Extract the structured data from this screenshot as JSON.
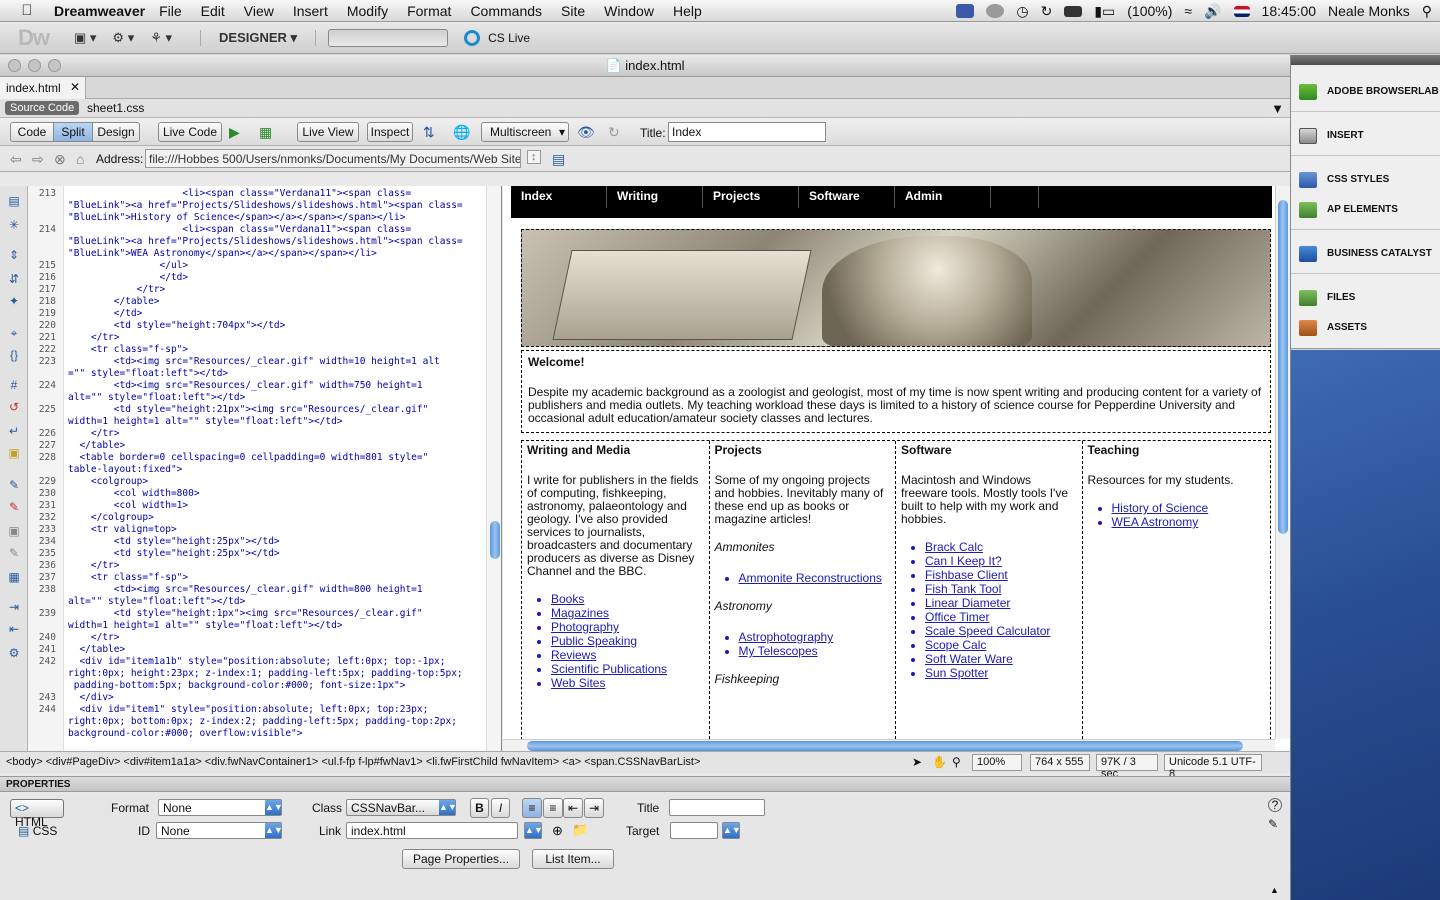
{
  "menubar": {
    "app_name": "Dreamweaver",
    "items": [
      "File",
      "Edit",
      "View",
      "Insert",
      "Modify",
      "Format",
      "Commands",
      "Site",
      "Window",
      "Help"
    ],
    "battery": "(100%)",
    "clock": "18:45:00",
    "user": "Neale Monks"
  },
  "appbar": {
    "logo": "Dw",
    "workspace": "DESIGNER ▾",
    "cslive": "CS Live"
  },
  "window": {
    "title": "index.html"
  },
  "tabs": {
    "active": "index.html"
  },
  "related": {
    "source": "Source Code",
    "css": "sheet1.css"
  },
  "toolbar": {
    "code": "Code",
    "split": "Split",
    "design": "Design",
    "live_code": "Live Code",
    "live_view": "Live View",
    "inspect": "Inspect",
    "multiscreen": "Multiscreen",
    "title_label": "Title:",
    "title_value": "Index"
  },
  "address": {
    "label": "Address:",
    "value": "file:///Hobbes 500/Users/nmonks/Documents/My Documents/Web Sites/M"
  },
  "code": {
    "line_numbers": [
      "213",
      "214",
      "215",
      "216",
      "217",
      "218",
      "219",
      "220",
      "221",
      "222",
      "223",
      "224",
      "225",
      "226",
      "227",
      "228",
      "229",
      "230",
      "231",
      "232",
      "233",
      "234",
      "235",
      "236",
      "237",
      "238",
      "239",
      "240",
      "241",
      "242",
      "243",
      "244"
    ],
    "lines": [
      "                    <li><span class=\"Verdana11\"><span class=\n\"BlueLink\"><a href=\"Projects/Slideshows/slideshows.html\"><span class=\n\"BlueLink\">History of Science</span></a></span></span></li>",
      "                    <li><span class=\"Verdana11\"><span class=\n\"BlueLink\"><a href=\"Projects/Slideshows/slideshows.html\"><span class=\n\"BlueLink\">WEA Astronomy</span></a></span></span></li>",
      "                </ul>",
      "                </td>",
      "            </tr>",
      "        </table>",
      "        </td>",
      "        <td style=\"height:704px\"></td>",
      "    </tr>",
      "    <tr class=\"f-sp\">",
      "        <td><img src=\"Resources/_clear.gif\" width=10 height=1 alt\n=\"\" style=\"float:left\"></td>",
      "        <td><img src=\"Resources/_clear.gif\" width=750 height=1\nalt=\"\" style=\"float:left\"></td>",
      "        <td style=\"height:21px\"><img src=\"Resources/_clear.gif\"\nwidth=1 height=1 alt=\"\" style=\"float:left\"></td>",
      "    </tr>",
      "  </table>",
      "  <table border=0 cellspacing=0 cellpadding=0 width=801 style=\"\ntable-layout:fixed\">",
      "    <colgroup>",
      "        <col width=800>",
      "        <col width=1>",
      "    </colgroup>",
      "    <tr valign=top>",
      "        <td style=\"height:25px\"></td>",
      "        <td style=\"height:25px\"></td>",
      "    </tr>",
      "    <tr class=\"f-sp\">",
      "        <td><img src=\"Resources/_clear.gif\" width=800 height=1\nalt=\"\" style=\"float:left\"></td>",
      "        <td style=\"height:1px\"><img src=\"Resources/_clear.gif\"\nwidth=1 height=1 alt=\"\" style=\"float:left\"></td>",
      "    </tr>",
      "  </table>",
      "  <div id=\"item1a1b\" style=\"position:absolute; left:0px; top:-1px;\nright:0px; height:23px; z-index:1; padding-left:5px; padding-top:5px;\n padding-bottom:5px; background-color:#000; font-size:1px\">",
      "  </div>",
      "  <div id=\"item1\" style=\"position:absolute; left:0px; top:23px;\nright:0px; bottom:0px; z-index:2; padding-left:5px; padding-top:2px;\nbackground-color:#000; overflow:visible\">"
    ]
  },
  "design": {
    "nav": [
      "Index",
      "Writing",
      "Projects",
      "Software",
      "Admin"
    ],
    "welcome_title": "Welcome!",
    "welcome_text": "Despite my academic background as a zoologist and geologist, most of my time is now spent writing and producing content for a variety of publishers and media outlets. My teaching workload these days is limited to a history of science course for Pepperdine University and occasional adult education/amateur society classes and lectures.",
    "writing": {
      "title": "Writing and Media",
      "text": "I write for publishers in the fields of computing, fishkeeping, astronomy, palaeontology and geology. I've also provided services to journalists, broadcasters and documentary producers as diverse as Disney Channel and the BBC.",
      "links": [
        "Books",
        "Magazines",
        "Photography",
        "Public Speaking",
        "Reviews",
        "Scientific Publications",
        "Web Sites"
      ]
    },
    "projects": {
      "title": "Projects",
      "text": "Some of my ongoing projects and hobbies. Inevitably many of these end up as books or magazine articles!",
      "group1": "Ammonites",
      "group1_links": [
        "Ammonite Reconstructions"
      ],
      "group2": "Astronomy",
      "group2_links": [
        "Astrophotography",
        "My Telescopes"
      ],
      "group3": "Fishkeeping"
    },
    "software": {
      "title": "Software",
      "text": "Macintosh and Windows freeware tools. Mostly tools I've built to help with my work and hobbies.",
      "links": [
        "Brack Calc",
        "Can I Keep It?",
        "Fishbase Client",
        "Fish Tank Tool",
        "Linear Diameter",
        "Office Timer",
        "Scale Speed Calculator",
        "Scope Calc",
        "Soft Water Ware",
        "Sun Spotter"
      ]
    },
    "teaching": {
      "title": "Teaching",
      "text": "Resources for my students.",
      "links": [
        "History of Science",
        "WEA Astronomy"
      ]
    }
  },
  "status": {
    "tag_selector": "<body> <div#PageDiv> <div#item1a1a> <div.fwNavContainer1> <ul.f-fp f-lp#fwNav1> <li.fwFirstChild fwNavItem> <a> <span.CSSNavBarList>",
    "zoom": "100%",
    "window_size": "764 x 555",
    "download": "97K / 3 sec",
    "encoding": "Unicode 5.1 UTF-8"
  },
  "properties": {
    "header": "PROPERTIES",
    "html_tab": "HTML",
    "css_tab": "CSS",
    "format_label": "Format",
    "format_value": "None",
    "id_label": "ID",
    "id_value": "None",
    "class_label": "Class",
    "class_value": "CSSNavBar...",
    "link_label": "Link",
    "link_value": "index.html",
    "title_label": "Title",
    "target_label": "Target",
    "page_properties": "Page Properties...",
    "list_item": "List Item..."
  },
  "panels": {
    "items": [
      "ADOBE BROWSERLAB",
      "INSERT",
      "CSS STYLES",
      "AP ELEMENTS",
      "BUSINESS CATALYST",
      "FILES",
      "ASSETS"
    ]
  }
}
